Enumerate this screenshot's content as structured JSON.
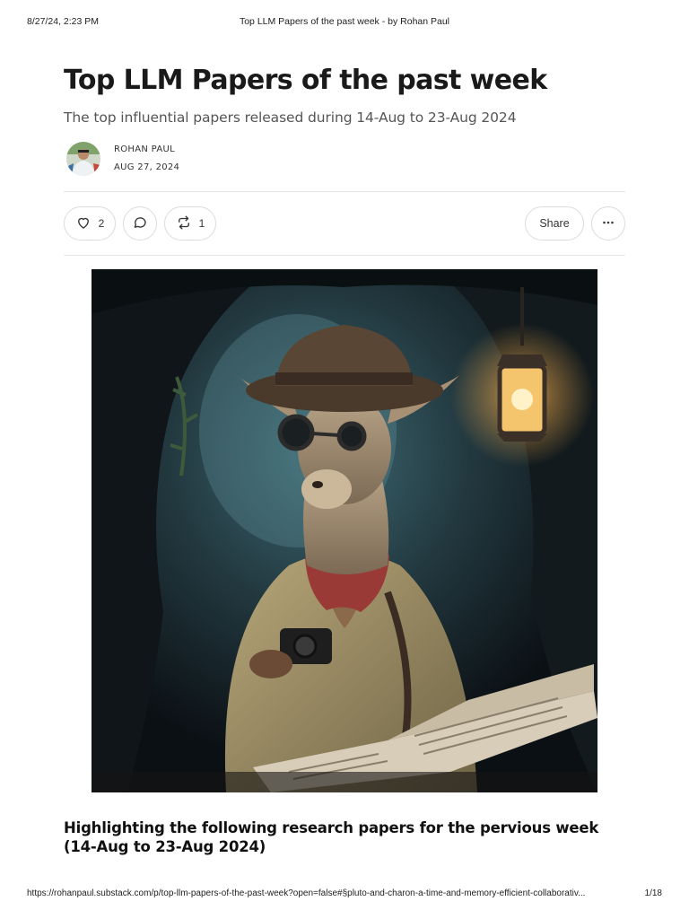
{
  "print_header": {
    "datetime": "8/27/24, 2:23 PM",
    "title": "Top LLM Papers of the past week - by Rohan Paul"
  },
  "post": {
    "title": "Top LLM Papers of the past week",
    "subtitle": "The top influential papers released during 14-Aug to 23-Aug 2024",
    "author": "ROHAN PAUL",
    "date": "AUG 27, 2024"
  },
  "actions": {
    "like": {
      "icon": "heart-icon",
      "count": "2"
    },
    "comment": {
      "icon": "comment-icon"
    },
    "restack": {
      "icon": "restack-icon",
      "count": "1"
    },
    "share_label": "Share",
    "more": {
      "icon": "ellipsis-icon"
    }
  },
  "section_heading": "Highlighting the following research papers for the pervious week (14-Aug to 23-Aug 2024)",
  "print_footer": {
    "url": "https://rohanpaul.substack.com/p/top-llm-papers-of-the-past-week?open=false#§pluto-and-charon-a-time-and-memory-efficient-collaborativ...",
    "page": "1/18"
  },
  "colors": {
    "text": "#1a1a1a",
    "muted": "#555555",
    "border": "#dcdcdc"
  }
}
